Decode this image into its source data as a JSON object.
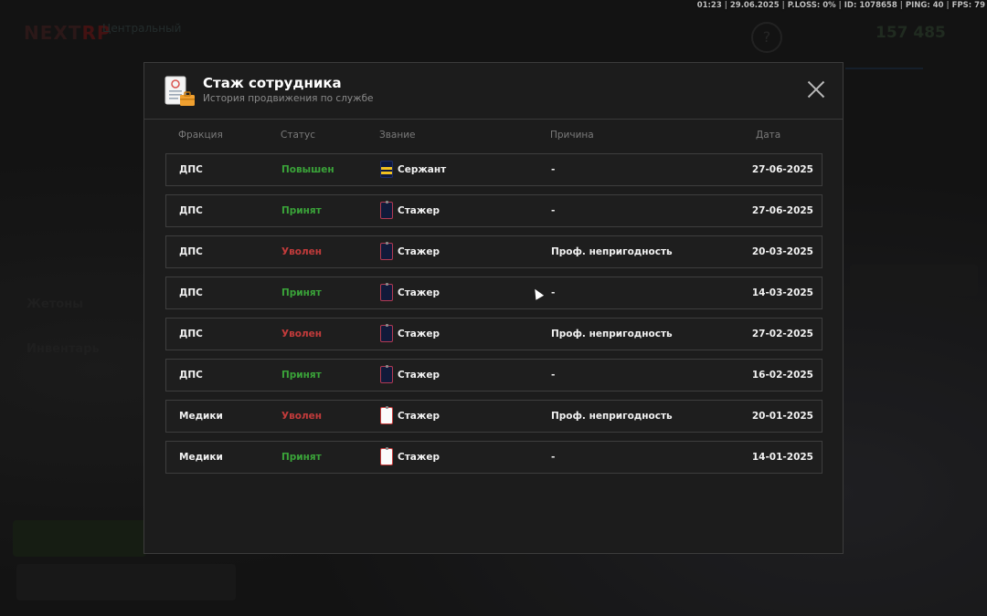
{
  "statusbar": {
    "time": "01:23",
    "date": "29.06.2025",
    "ploss": "P.LOSS: 0%",
    "id": "ID: 1078658",
    "ping": "PING: 40",
    "fps": "FPS: 79"
  },
  "background": {
    "logo_a": "NEXT",
    "logo_b": "RP",
    "subtitle": "Центральный",
    "money": "157 485",
    "tokens_label": "Жетоны",
    "inventory_label": "Инвентарь"
  },
  "modal": {
    "title": "Стаж сотрудника",
    "subtitle": "История продвижения по службе",
    "columns": {
      "faction": "Фракция",
      "status": "Статус",
      "rank": "Звание",
      "reason": "Причина",
      "date": "Дата"
    },
    "rows": [
      {
        "faction": "ДПС",
        "status": "Повышен",
        "status_color": "green",
        "rank": "Сержант",
        "rank_icon": "sergeant-badge",
        "reason": "-",
        "date": "27-06-2025"
      },
      {
        "faction": "ДПС",
        "status": "Принят",
        "status_color": "green",
        "rank": "Стажер",
        "rank_icon": "dps-badge",
        "reason": "-",
        "date": "27-06-2025"
      },
      {
        "faction": "ДПС",
        "status": "Уволен",
        "status_color": "red",
        "rank": "Стажер",
        "rank_icon": "dps-badge",
        "reason": "Проф. непригодность",
        "date": "20-03-2025"
      },
      {
        "faction": "ДПС",
        "status": "Принят",
        "status_color": "green",
        "rank": "Стажер",
        "rank_icon": "dps-badge",
        "reason": "-",
        "date": "14-03-2025"
      },
      {
        "faction": "ДПС",
        "status": "Уволен",
        "status_color": "red",
        "rank": "Стажер",
        "rank_icon": "dps-badge",
        "reason": "Проф. непригодность",
        "date": "27-02-2025"
      },
      {
        "faction": "ДПС",
        "status": "Принят",
        "status_color": "green",
        "rank": "Стажер",
        "rank_icon": "dps-badge",
        "reason": "-",
        "date": "16-02-2025"
      },
      {
        "faction": "Медики",
        "status": "Уволен",
        "status_color": "red",
        "rank": "Стажер",
        "rank_icon": "medic-badge",
        "reason": "Проф. непригодность",
        "date": "20-01-2025"
      },
      {
        "faction": "Медики",
        "status": "Принят",
        "status_color": "green",
        "rank": "Стажер",
        "rank_icon": "medic-badge",
        "reason": "-",
        "date": "14-01-2025"
      }
    ]
  },
  "colors": {
    "status_green": "#3aa339",
    "status_red": "#c23b3b",
    "modal_bg": "#1c1c1c"
  }
}
